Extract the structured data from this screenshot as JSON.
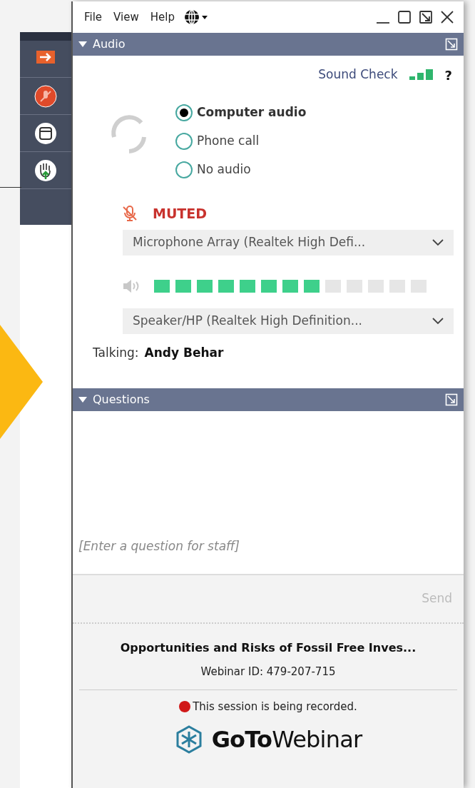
{
  "menu": [
    "File",
    "View",
    "Help"
  ],
  "side_toolbar": [
    {
      "kind": "arrow"
    },
    {
      "kind": "mic"
    },
    {
      "kind": "window"
    },
    {
      "kind": "hand"
    }
  ],
  "audio": {
    "title": "Audio",
    "expanded": true,
    "sound_check": "Sound Check",
    "help": "?",
    "options": [
      {
        "label": "Computer audio",
        "selected": true
      },
      {
        "label": "Phone call",
        "selected": false
      },
      {
        "label": "No audio",
        "selected": false
      }
    ],
    "muted": true,
    "muted_label": "MUTED",
    "microphone": "Microphone Array (Realtek High Defi...",
    "speaker_meter": {
      "level": 0.615
    },
    "speaker": "Speaker/HP (Realtek High Definition...",
    "talking_label": "Talking:",
    "talking_name": "Andy Behar"
  },
  "questions": {
    "title": "Questions",
    "expanded": true,
    "placeholder": "[Enter a question for staff]",
    "send": "Send"
  },
  "footer": {
    "title": "Opportunities and Risks of Fossil Free Inves...",
    "webinar_id": "Webinar ID: 479-207-715",
    "recording": "This session is being recorded.",
    "logo": "**GoTo**Webinar"
  }
}
